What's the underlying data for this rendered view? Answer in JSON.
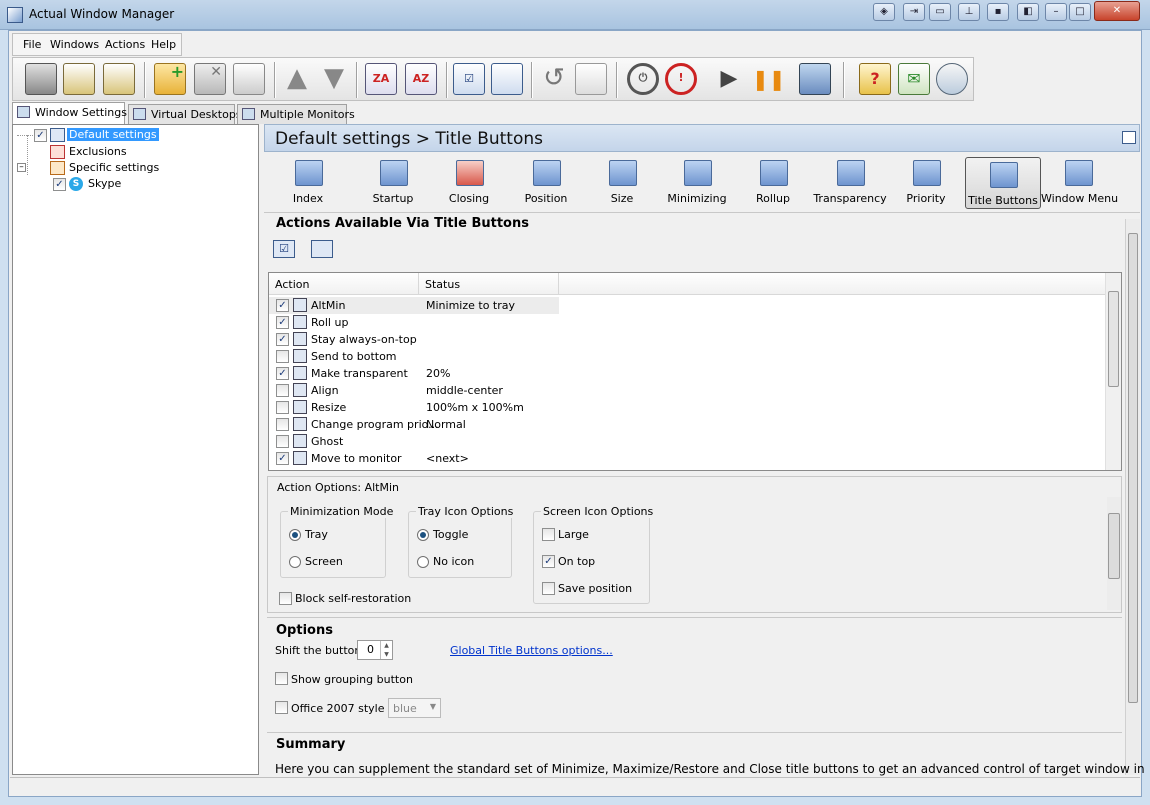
{
  "window": {
    "title": "Actual Window Manager"
  },
  "menu": [
    "File",
    "Windows",
    "Actions",
    "Help"
  ],
  "toolbar_icons": [
    "save-icon",
    "profile-icon",
    "profiles-icon",
    "add-icon",
    "delete-icon",
    "copy-icon",
    "move-up-icon",
    "move-down-icon",
    "sort-az-icon",
    "sort-za-icon",
    "check-all-icon",
    "uncheck-all-icon",
    "undo-icon",
    "import-icon",
    "power-icon",
    "stop-icon",
    "play-icon",
    "pause-icon",
    "tools-icon",
    "help-icon",
    "email-icon",
    "support-icon"
  ],
  "tabs": [
    "Window Settings",
    "Virtual Desktops",
    "Multiple Monitors"
  ],
  "tree": {
    "root": "Default settings",
    "exclusions": "Exclusions",
    "specific": "Specific settings",
    "skype": "Skype"
  },
  "header": {
    "title": "Default settings > Title Buttons"
  },
  "categories": [
    "Index",
    "Startup",
    "Closing",
    "Position",
    "Size",
    "Minimizing",
    "Rollup",
    "Transparency",
    "Priority",
    "Title Buttons",
    "Window Menu"
  ],
  "actions_section": {
    "title": "Actions Available Via Title Buttons"
  },
  "list": {
    "columns": [
      "Action",
      "Status"
    ],
    "rows": [
      {
        "action": "AltMin",
        "status": "Minimize to tray",
        "checked": true
      },
      {
        "action": "Roll up",
        "status": "",
        "checked": true
      },
      {
        "action": "Stay always-on-top",
        "status": "",
        "checked": true
      },
      {
        "action": "Send to bottom",
        "status": "",
        "checked": false
      },
      {
        "action": "Make transparent",
        "status": "20%",
        "checked": true
      },
      {
        "action": "Align",
        "status": "middle-center",
        "checked": false
      },
      {
        "action": "Resize",
        "status": "100%m x 100%m",
        "checked": false
      },
      {
        "action": "Change program prio...",
        "status": "Normal",
        "checked": false
      },
      {
        "action": "Ghost",
        "status": "",
        "checked": false
      },
      {
        "action": "Move to monitor",
        "status": "<next>",
        "checked": true
      }
    ]
  },
  "action_options": {
    "title": "Action Options: AltMin",
    "minimization_mode": {
      "title": "Minimization Mode",
      "tray": "Tray",
      "screen": "Screen"
    },
    "tray_icon": {
      "title": "Tray Icon Options",
      "toggle": "Toggle",
      "no_icon": "No icon"
    },
    "screen_icon": {
      "title": "Screen Icon Options",
      "large": "Large",
      "on_top": "On top",
      "save_position": "Save position"
    },
    "block": "Block self-restoration"
  },
  "options": {
    "title": "Options",
    "shift_label": "Shift the buttons",
    "shift_value": "0",
    "global_link": "Global Title Buttons options...",
    "show_grouping": "Show grouping button",
    "office_style": "Office 2007 style",
    "office_value": "blue"
  },
  "summary": {
    "title": "Summary",
    "text": "Here you can supplement the standard set of Minimize, Maximize/Restore and Close title buttons to get an advanced control of target window in"
  }
}
